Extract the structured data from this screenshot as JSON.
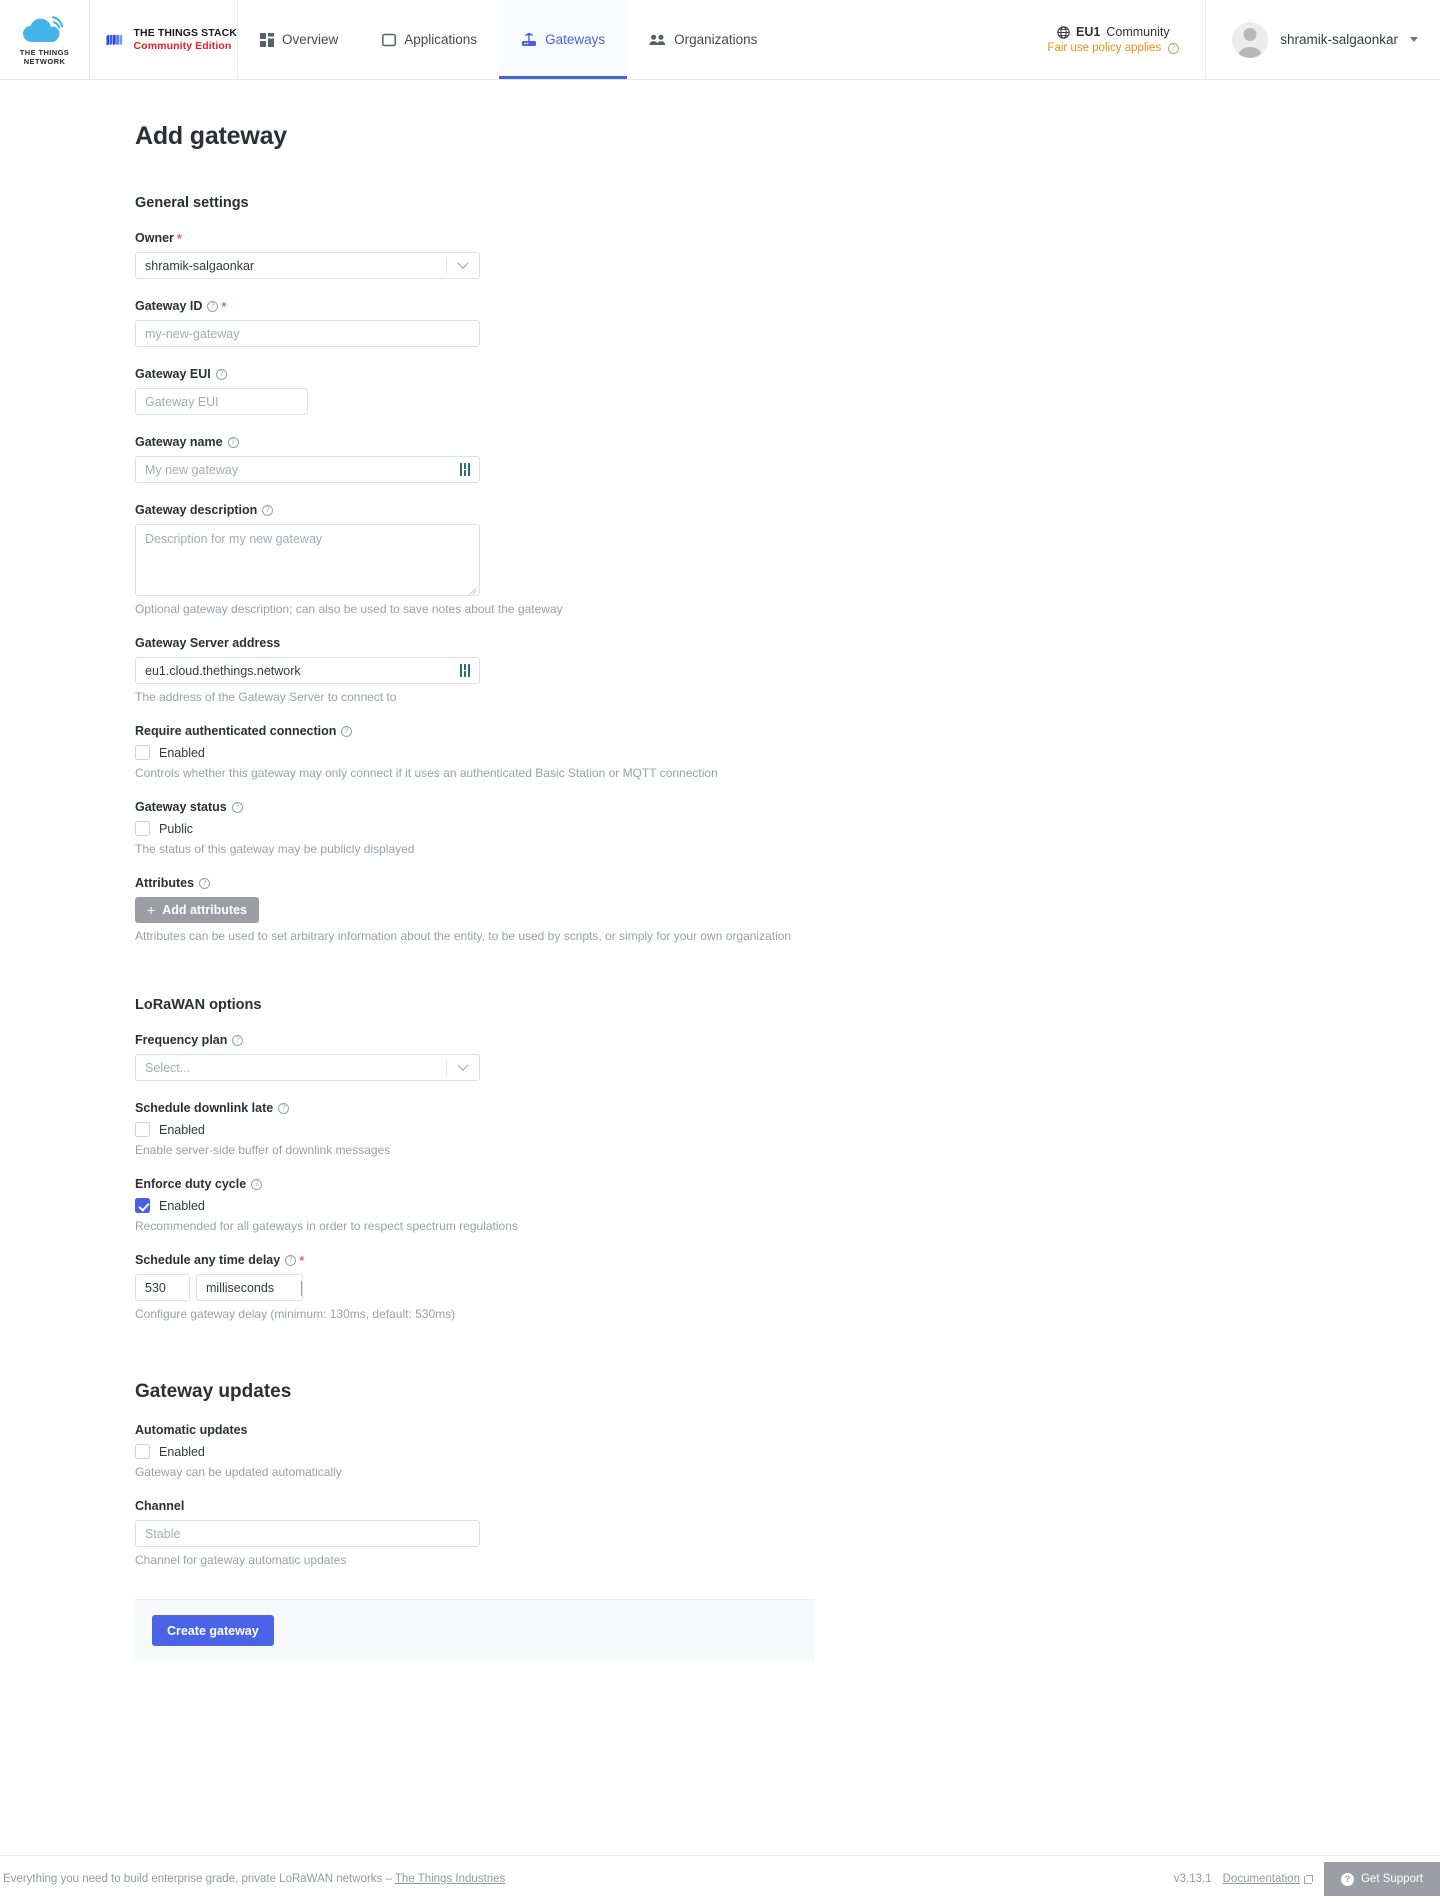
{
  "header": {
    "ttn_logo_line1": "THE THINGS",
    "ttn_logo_line2": "NETWORK",
    "brand_line1": "THE THINGS STACK",
    "brand_line2": "Community Edition",
    "nav": [
      {
        "label": "Overview",
        "icon": "grid-icon",
        "active": false
      },
      {
        "label": "Applications",
        "icon": "application-icon",
        "active": false
      },
      {
        "label": "Gateways",
        "icon": "gateway-icon",
        "active": true
      },
      {
        "label": "Organizations",
        "icon": "organizations-icon",
        "active": false
      }
    ],
    "cluster": {
      "code": "EU1",
      "name": "Community",
      "notice": "Fair use policy applies"
    },
    "user": {
      "name": "shramik-salgaonkar"
    }
  },
  "page": {
    "title": "Add gateway",
    "sections": {
      "general": "General settings",
      "lorawan": "LoRaWAN options",
      "updates": "Gateway updates"
    }
  },
  "fields": {
    "owner": {
      "label": "Owner",
      "value": "shramik-salgaonkar",
      "required": true
    },
    "gateway_id": {
      "label": "Gateway ID",
      "placeholder": "my-new-gateway",
      "required": true
    },
    "gateway_eui": {
      "label": "Gateway EUI",
      "placeholder": "Gateway EUI"
    },
    "gateway_name": {
      "label": "Gateway name",
      "placeholder": "My new gateway"
    },
    "gateway_description": {
      "label": "Gateway description",
      "placeholder": "Description for my new gateway",
      "hint": "Optional gateway description; can also be used to save notes about the gateway"
    },
    "gateway_server_address": {
      "label": "Gateway Server address",
      "value": "eu1.cloud.thethings.network",
      "hint": "The address of the Gateway Server to connect to"
    },
    "require_auth": {
      "label": "Require authenticated connection",
      "checkbox_label": "Enabled",
      "checked": false,
      "hint": "Controls whether this gateway may only connect if it uses an authenticated Basic Station or MQTT connection"
    },
    "gateway_status": {
      "label": "Gateway status",
      "checkbox_label": "Public",
      "checked": false,
      "hint": "The status of this gateway may be publicly displayed"
    },
    "attributes": {
      "label": "Attributes",
      "button_label": "Add attributes",
      "hint": "Attributes can be used to set arbitrary information about the entity, to be used by scripts, or simply for your own organization"
    },
    "frequency_plan": {
      "label": "Frequency plan",
      "placeholder": "Select..."
    },
    "schedule_downlink_late": {
      "label": "Schedule downlink late",
      "checkbox_label": "Enabled",
      "checked": false,
      "hint": "Enable server-side buffer of downlink messages"
    },
    "enforce_duty_cycle": {
      "label": "Enforce duty cycle",
      "checkbox_label": "Enabled",
      "checked": true,
      "hint": "Recommended for all gateways in order to respect spectrum regulations"
    },
    "schedule_any_time_delay": {
      "label": "Schedule any time delay",
      "required": true,
      "value": "530",
      "unit": "milliseconds",
      "hint": "Configure gateway delay (minimum: 130ms, default: 530ms)"
    },
    "automatic_updates": {
      "label": "Automatic updates",
      "checkbox_label": "Enabled",
      "checked": false,
      "hint": "Gateway can be updated automatically"
    },
    "channel": {
      "label": "Channel",
      "placeholder": "Stable",
      "hint": "Channel for gateway automatic updates"
    }
  },
  "submit": {
    "label": "Create gateway"
  },
  "footer": {
    "tagline": "Everything you need to build enterprise grade, private LoRaWAN networks – ",
    "tagline_link": "The Things Industries",
    "version": "v3.13.1",
    "documentation": "Documentation",
    "support": "Get Support"
  },
  "colors": {
    "accent": "#4660e8",
    "warning": "#e8901a",
    "required": "#e8656f",
    "brand_red": "#eb1f24"
  }
}
